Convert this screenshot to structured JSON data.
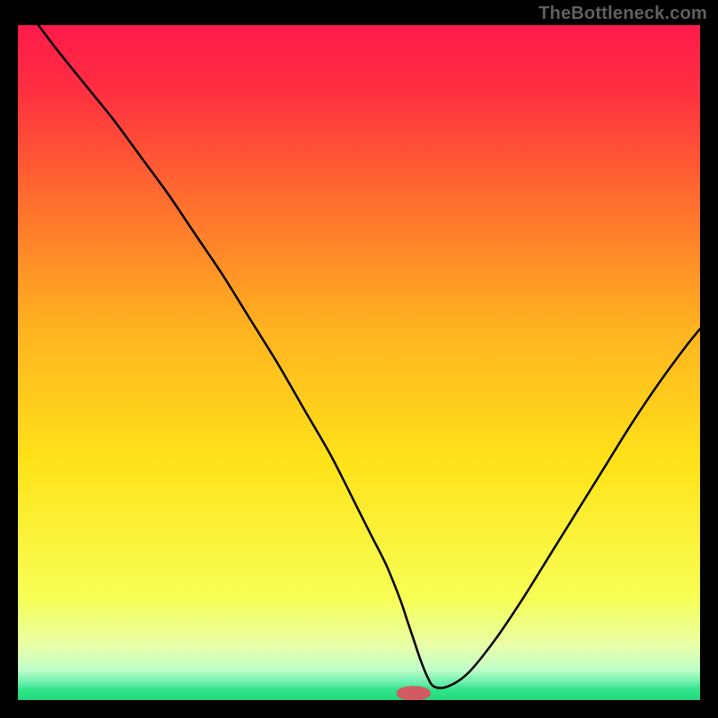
{
  "watermark": "TheBottleneck.com",
  "chart_data": {
    "type": "line",
    "title": "",
    "xlabel": "",
    "ylabel": "",
    "xlim": [
      0,
      100
    ],
    "ylim": [
      0,
      100
    ],
    "background_gradient": {
      "stops": [
        {
          "offset": 0.0,
          "color": "#ff1a4b"
        },
        {
          "offset": 0.1,
          "color": "#ff3040"
        },
        {
          "offset": 0.25,
          "color": "#ff6a2f"
        },
        {
          "offset": 0.45,
          "color": "#ffb320"
        },
        {
          "offset": 0.65,
          "color": "#ffe31a"
        },
        {
          "offset": 0.85,
          "color": "#f7ff55"
        },
        {
          "offset": 0.92,
          "color": "#e8ffa8"
        },
        {
          "offset": 0.955,
          "color": "#c0ffca"
        },
        {
          "offset": 0.975,
          "color": "#66eeaa"
        },
        {
          "offset": 0.985,
          "color": "#2fe489"
        },
        {
          "offset": 1.0,
          "color": "#23d87e"
        }
      ]
    },
    "series": [
      {
        "name": "bottleneck-curve",
        "color": "#000000",
        "width": 2.5,
        "x": [
          3,
          6,
          10,
          14,
          18,
          22,
          26,
          30,
          34,
          38,
          42,
          46,
          50,
          52,
          54,
          56,
          57,
          58,
          59,
          60,
          61,
          63,
          66,
          70,
          74,
          78,
          82,
          86,
          90,
          94,
          98,
          100
        ],
        "y": [
          100,
          96,
          91,
          86,
          80.5,
          75,
          69,
          63,
          56.5,
          50,
          43,
          36,
          28,
          24,
          20,
          15,
          12,
          9,
          6,
          3.5,
          2,
          2,
          4,
          9,
          15,
          21.5,
          28,
          34.5,
          41,
          47,
          52.5,
          55
        ]
      }
    ],
    "marker": {
      "name": "bottleneck-marker",
      "color": "#d15b63",
      "x": 58,
      "y": 1,
      "rx": 4,
      "width": 5,
      "height": 2.2
    }
  }
}
